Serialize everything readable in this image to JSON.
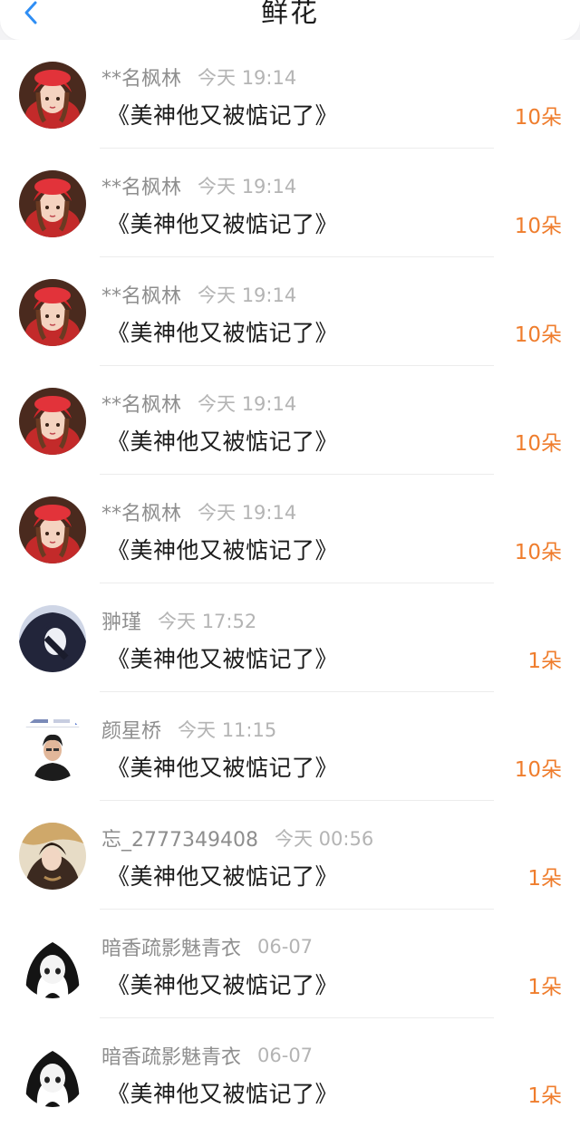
{
  "header": {
    "title": "鲜花",
    "back_icon": "chevron-left-icon",
    "accent_color": "#2f8ef4"
  },
  "colors": {
    "amount": "#ef7d2d",
    "username": "#8e8e8e",
    "time": "#b4b4b4"
  },
  "items": [
    {
      "user": "**名枫林",
      "time": "今天 19:14",
      "book": "《美神他又被惦记了》",
      "amount": "10朵",
      "avatar": "girl-red-hat-avatar"
    },
    {
      "user": "**名枫林",
      "time": "今天 19:14",
      "book": "《美神他又被惦记了》",
      "amount": "10朵",
      "avatar": "girl-red-hat-avatar"
    },
    {
      "user": "**名枫林",
      "time": "今天 19:14",
      "book": "《美神他又被惦记了》",
      "amount": "10朵",
      "avatar": "girl-red-hat-avatar"
    },
    {
      "user": "**名枫林",
      "time": "今天 19:14",
      "book": "《美神他又被惦记了》",
      "amount": "10朵",
      "avatar": "girl-red-hat-avatar"
    },
    {
      "user": "**名枫林",
      "time": "今天 19:14",
      "book": "《美神他又被惦记了》",
      "amount": "10朵",
      "avatar": "girl-red-hat-avatar"
    },
    {
      "user": "翀瑾",
      "time": "今天 17:52",
      "book": "《美神他又被惦记了》",
      "amount": "1朵",
      "avatar": "dark-hair-anime-avatar"
    },
    {
      "user": "颜星桥",
      "time": "今天 11:15",
      "book": "《美神他又被惦记了》",
      "amount": "10朵",
      "avatar": "photo-boy-avatar"
    },
    {
      "user": "忘_2777349408",
      "time": "今天 00:56",
      "book": "《美神他又被惦记了》",
      "amount": "1朵",
      "avatar": "ancient-style-avatar"
    },
    {
      "user": "暗香疏影魅青衣",
      "time": "06-07",
      "book": "《美神他又被惦记了》",
      "amount": "1朵",
      "avatar": "monochrome-girl-avatar"
    },
    {
      "user": "暗香疏影魅青衣",
      "time": "06-07",
      "book": "《美神他又被惦记了》",
      "amount": "1朵",
      "avatar": "monochrome-girl-avatar"
    }
  ]
}
